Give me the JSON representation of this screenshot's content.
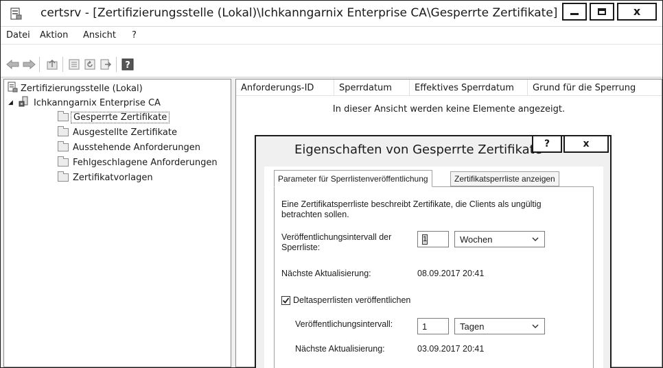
{
  "window": {
    "title": "certsrv - [Zertifizierungsstelle (Lokal)\\Ichkanngarnix Enterprise CA\\Gesperrte Zertifikate]",
    "close_label": "x"
  },
  "menubar": {
    "items": [
      "Datei",
      "Aktion",
      "Ansicht",
      "?"
    ]
  },
  "toolbar": {
    "icons": [
      "back-arrow-icon",
      "forward-arrow-icon",
      "up-folder-icon",
      "properties-icon",
      "refresh-icon",
      "export-list-icon",
      "help-icon"
    ],
    "help_glyph": "?"
  },
  "tree": {
    "root": "Zertifizierungsstelle (Lokal)",
    "ca": "Ichkanngarnix Enterprise CA",
    "expander": "◢",
    "items": [
      "Gesperrte Zertifikate",
      "Ausgestellte Zertifikate",
      "Ausstehende Anforderungen",
      "Fehlgeschlagene Anforderungen",
      "Zertifikatvorlagen"
    ],
    "selected_index": 0
  },
  "list": {
    "columns": [
      "Anforderungs-ID",
      "Sperrdatum",
      "Effektives Sperrdatum",
      "Grund für die Sperrung"
    ],
    "empty_message": "In dieser Ansicht werden keine Elemente angezeigt."
  },
  "dialog": {
    "title": "Eigenschaften von Gesperrte Zertifikate",
    "help_label": "?",
    "close_label": "x",
    "tabs": [
      "Parameter für Sperrlistenveröffentlichung",
      "Zertifikatsperrliste anzeigen"
    ],
    "description_line1": "Eine Zertifikatsperrliste beschreibt Zertifikate, die Clients als ungültig",
    "description_line2": "betrachten sollen.",
    "interval_label_line1": "Veröffentlichungsintervall der",
    "interval_label_line2": "Sperrliste:",
    "interval_value": "1",
    "interval_unit": "Wochen",
    "next_update_label": "Nächste Aktualisierung:",
    "next_update_value": "08.09.2017 20:41",
    "delta_checkbox_label": "Deltasperrlisten veröffentlichen",
    "delta_checked": true,
    "delta_interval_label": "Veröffentlichungsintervall:",
    "delta_interval_value": "1",
    "delta_interval_unit": "Tagen",
    "delta_next_update_label": "Nächste Aktualisierung:",
    "delta_next_update_value": "03.09.2017 20:41"
  }
}
